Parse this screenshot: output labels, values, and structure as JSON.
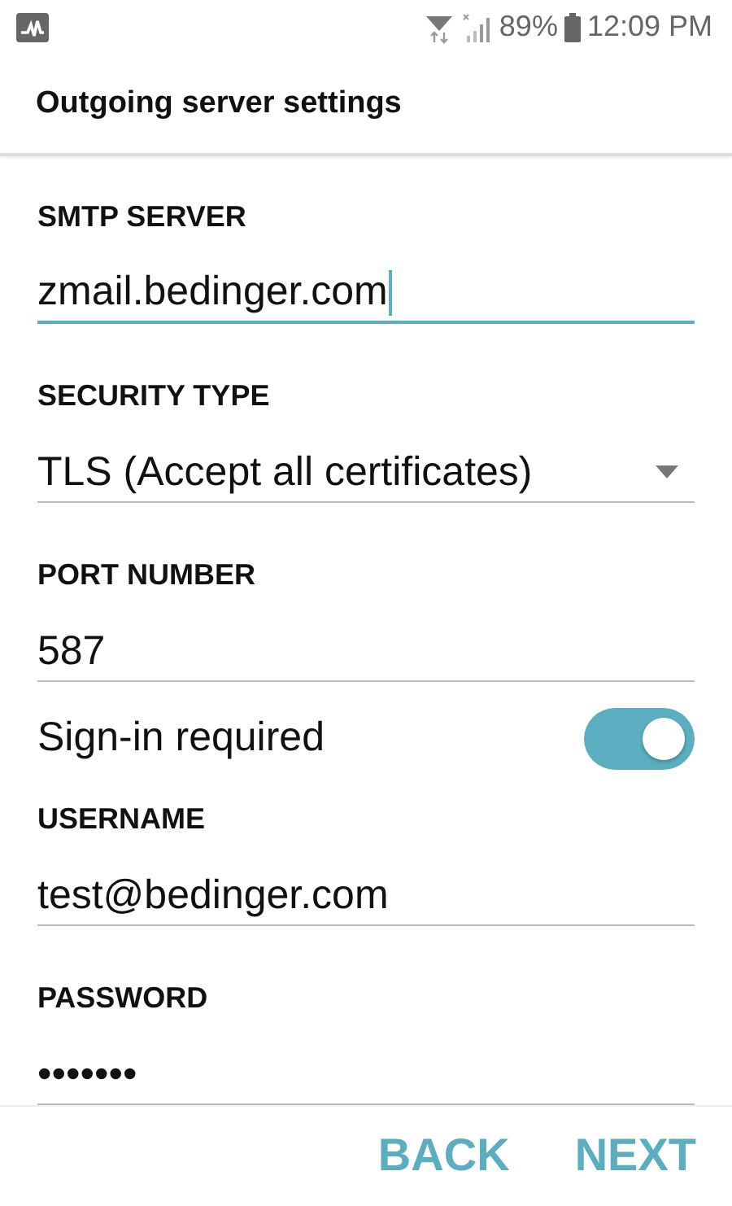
{
  "status_bar": {
    "battery": "89%",
    "time": "12:09 PM"
  },
  "title": "Outgoing server settings",
  "fields": [
    {
      "kind": "text",
      "label": "SMTP SERVER",
      "value": "zmail.bedinger.com",
      "focused": true
    },
    {
      "kind": "dropdown",
      "label": "SECURITY TYPE",
      "value": "TLS (Accept all certificates)",
      "focused": false
    },
    {
      "kind": "text",
      "label": "PORT NUMBER",
      "value": "587",
      "focused": false
    },
    {
      "kind": "toggle",
      "label": "Sign-in required",
      "on": true
    },
    {
      "kind": "text",
      "label": "USERNAME",
      "value": "test@bedinger.com",
      "focused": false
    },
    {
      "kind": "password",
      "label": "PASSWORD",
      "value": "•••••••",
      "focused": false
    }
  ],
  "buttons": [
    "BACK",
    "NEXT"
  ]
}
